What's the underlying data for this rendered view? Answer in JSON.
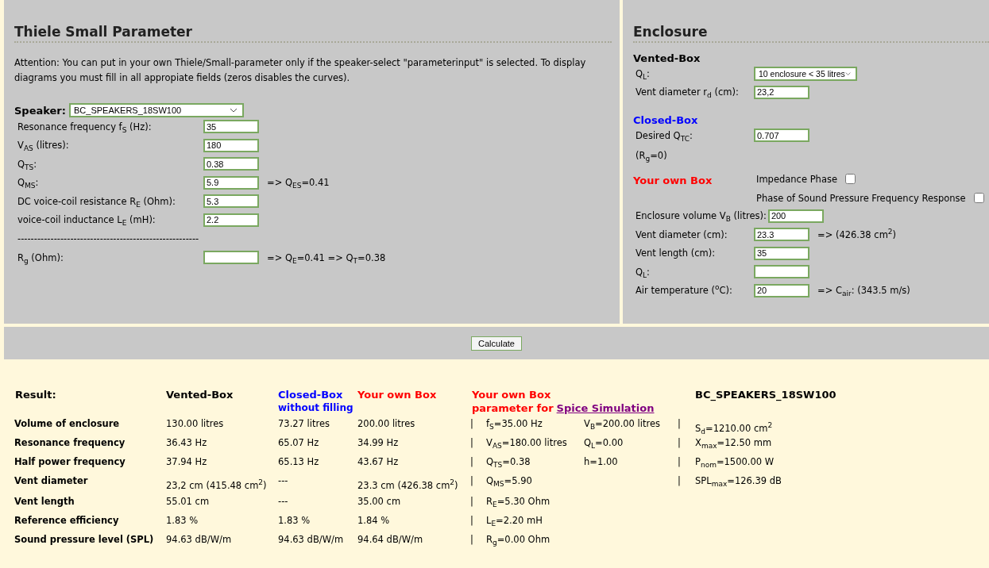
{
  "thiele_small": {
    "title": "Thiele Small Parameter",
    "note": "Attention: You can put in your own Thiele/Small-parameter only if the speaker-select \"parameterinput\" is selected. To display diagrams you must fill in all appropiate fields (zeros disables the curves).",
    "speaker": {
      "label": "Speaker:",
      "value": "BC_SPEAKERS_18SW100"
    },
    "fields": [
      {
        "label": "Resonance frequency f$_{S}$ (Hz):",
        "value": "35"
      },
      {
        "label": "V$_{AS}$ (litres):",
        "value": "180"
      },
      {
        "label": "Q$_{TS}$:",
        "value": "0.38"
      },
      {
        "label": "Q$_{MS}$:",
        "value": "5.9",
        "result": "=> Q$_{ES}$=0.41"
      },
      {
        "label": "DC voice-coil resistance R$_{E}$ (Ohm):",
        "value": "5.3"
      },
      {
        "label": "voice-coil inductance L$_{E}$ (mH):",
        "value": "2.2"
      }
    ],
    "separator": "-------------------------------------------------------",
    "rg": {
      "label": "R$_{g}$ (Ohm):",
      "result": "=> Q$_{E}$=0.41 => Q$_{T}$=0.38"
    }
  },
  "enclosure": {
    "title": "Enclosure",
    "vented_box": {
      "heading": "Vented-Box",
      "ql": {
        "label": "Q$_{L}$:",
        "value": "10 enclosure < 35 litres"
      },
      "vent": {
        "label": "Vent diameter r$_{d}$ (cm):",
        "value": "23,2"
      }
    },
    "closed_box": {
      "heading": "Closed-Box",
      "qtc": {
        "label": "Desired Q$_{TC}$:",
        "value": "0.707"
      },
      "note": "(R$_{g}$=0)"
    },
    "own_box": {
      "heading": "Your own Box",
      "options": [
        {
          "label": "Impedance Phase",
          "checked": false
        },
        {
          "label": "Phase of Sound Pressure Frequency Response",
          "checked": false
        }
      ],
      "fields": [
        {
          "label": "Enclosure volume V$_{B}$ (litres):",
          "value": "200"
        },
        {
          "label": "Vent diameter (cm):",
          "value": "23.3",
          "result": "=> (426.38 cm$^{2}$)"
        },
        {
          "label": "Vent length (cm):",
          "value": "35"
        },
        {
          "label": "Q$_{L}$:"
        },
        {
          "label": "Air temperature ($^{o}$C):",
          "value": "20",
          "result": "=> C$_{air}$: (343.5 m/s)"
        }
      ]
    }
  },
  "calculate_button": "Calculate",
  "results": {
    "title": "Result:",
    "columns": [
      {
        "heading": "Vented-Box",
        "color": "#000000"
      },
      {
        "heading": "Closed-Box",
        "subheading": "without filling",
        "color": "#0000ff"
      },
      {
        "heading": "Your own Box",
        "color": "#ff0000"
      }
    ],
    "spice": {
      "heading": "Your own Box",
      "subheading": "parameter for",
      "link": "Spice Simulation"
    },
    "speaker_heading": "BC_SPEAKERS_18SW100",
    "rows": [
      {
        "label": "Volume of enclosure",
        "values": [
          "130.00 litres",
          "73.27 litres",
          "200.00 litres"
        ],
        "bar_1": "|",
        "spice": [
          "f$_{S}$=35.00 Hz",
          "V$_{B}$=200.00 litres"
        ],
        "bar_2": "|",
        "speaker": "S$_{d}$=1210.00 cm$^{2}$"
      },
      {
        "label": "Resonance frequency",
        "values": [
          "36.43 Hz",
          "65.07 Hz",
          "34.99 Hz"
        ],
        "bar_1": "|",
        "spice": [
          "V$_{AS}$=180.00 litres",
          "Q$_{L}$=0.00"
        ],
        "bar_2": "|",
        "speaker": "X$_{max}$=12.50 mm"
      },
      {
        "label": "Half power frequency",
        "values": [
          "37.94 Hz",
          "65.13 Hz",
          "43.67 Hz"
        ],
        "bar_1": "|",
        "spice": [
          "Q$_{TS}$=0.38",
          "h=1.00"
        ],
        "bar_2": "|",
        "speaker": "P$_{nom}$=1500.00 W"
      },
      {
        "label": "Vent diameter",
        "values": [
          "23,2 cm (415.48 cm$^{2}$)",
          "---",
          "23.3 cm (426.38 cm$^{2}$)"
        ],
        "bar_1": "|",
        "spice": [
          "Q$_{MS}$=5.90"
        ],
        "bar_2": "|",
        "speaker": "SPL$_{max}$=126.39 dB"
      },
      {
        "label": "Vent length",
        "values": [
          "55.01 cm",
          "---",
          "35.00 cm"
        ],
        "bar_1": "|",
        "spice": [
          "R$_{E}$=5.30 Ohm"
        ]
      },
      {
        "label": "Reference efficiency",
        "values": [
          "1.83 %",
          "1.83 %",
          "1.84 %"
        ],
        "bar_1": "|",
        "spice": [
          "L$_{E}$=2.20 mH"
        ]
      },
      {
        "label": "Sound pressure level (SPL)",
        "values": [
          "94.63 dB/W/m",
          "94.63 dB/W/m",
          "94.64 dB/W/m"
        ],
        "bar_1": "|",
        "spice": [
          "R$_{g}$=0.00 Ohm"
        ]
      }
    ]
  }
}
